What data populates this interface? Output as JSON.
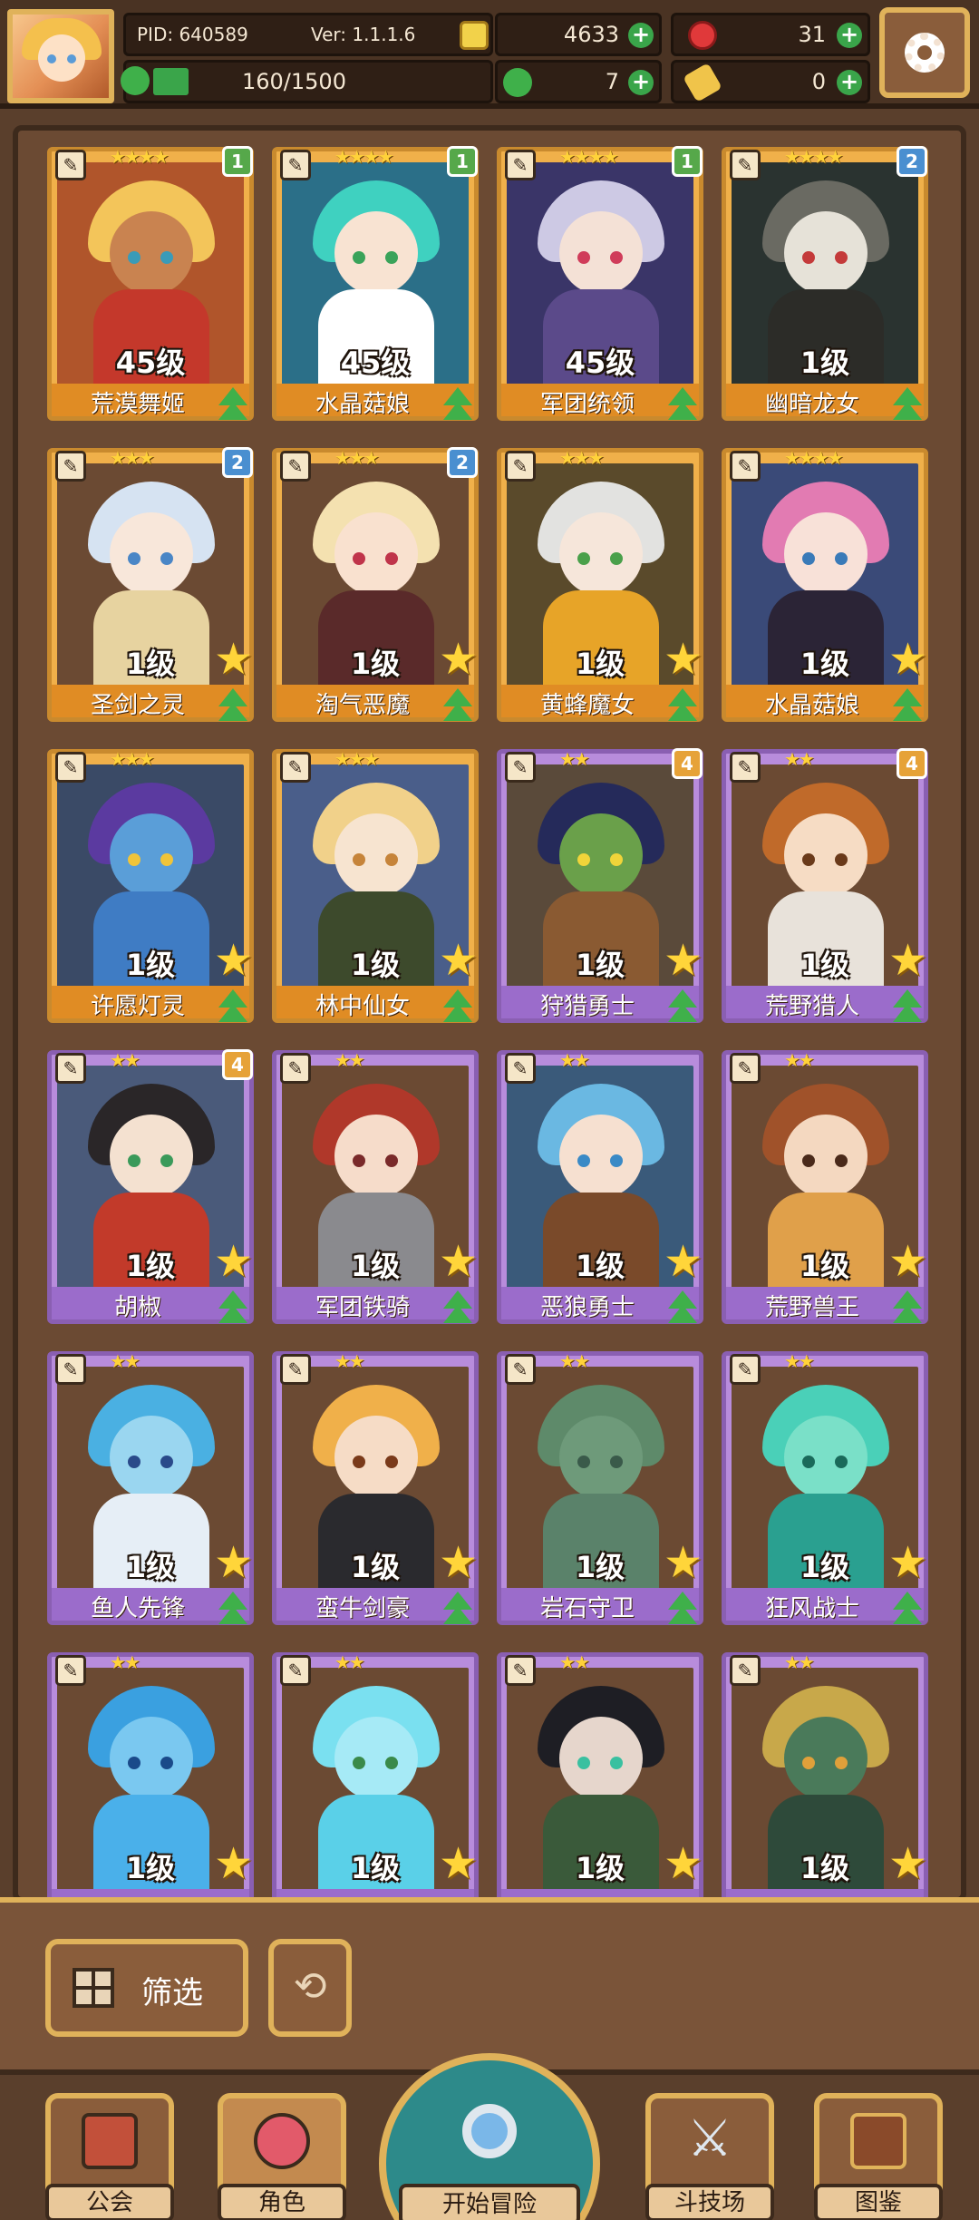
{
  "hud": {
    "pid": "PID: 640589",
    "version": "Ver: 1.1.1.6",
    "gold": "4633",
    "gems": "31",
    "exp": "160/1500",
    "exp_ratio": 0.107,
    "clover": "7",
    "scroll": "0"
  },
  "cards": [
    {
      "name": "荒漠舞姬",
      "level": "45级",
      "stars": "★★★★",
      "rarity": "gold",
      "badge": "1",
      "badge_color": "green",
      "upgrade": true,
      "star_icon": false,
      "palette": {
        "hair": "#f3c55a",
        "skin": "#c98350",
        "body": "#c4382b",
        "bg": "#b0552b",
        "eye": "#3a9bb8"
      }
    },
    {
      "name": "水晶菇娘",
      "level": "45级",
      "stars": "★★★★",
      "rarity": "gold",
      "badge": "1",
      "badge_color": "green",
      "upgrade": true,
      "star_icon": false,
      "palette": {
        "hair": "#3fd1c0",
        "skin": "#f8e3d2",
        "body": "#ffffff",
        "bg": "#2b6f88",
        "eye": "#3aa35a"
      }
    },
    {
      "name": "军团统领",
      "level": "45级",
      "stars": "★★★★",
      "rarity": "gold",
      "badge": "1",
      "badge_color": "green",
      "upgrade": true,
      "star_icon": false,
      "palette": {
        "hair": "#cdc9e4",
        "skin": "#f4e1d6",
        "body": "#5b4a8a",
        "bg": "#3a3568",
        "eye": "#d03c5a"
      }
    },
    {
      "name": "幽暗龙女",
      "level": "1级",
      "stars": "★★★★",
      "rarity": "gold",
      "badge": "2",
      "badge_color": "blue",
      "upgrade": true,
      "star_icon": false,
      "palette": {
        "hair": "#6a6a62",
        "skin": "#e6e2d8",
        "body": "#2c2c28",
        "bg": "#2a3330",
        "eye": "#c43a3a"
      }
    },
    {
      "name": "圣剑之灵",
      "level": "1级",
      "stars": "★★★",
      "rarity": "gold",
      "badge": "2",
      "badge_color": "blue",
      "upgrade": true,
      "star_icon": true,
      "palette": {
        "hair": "#d6e3f2",
        "skin": "#f8e7da",
        "body": "#e7d3a0",
        "bg": "#6b4a33",
        "eye": "#4a86c6"
      }
    },
    {
      "name": "淘气恶魔",
      "level": "1级",
      "stars": "★★★",
      "rarity": "gold",
      "badge": "2",
      "badge_color": "blue",
      "upgrade": true,
      "star_icon": true,
      "palette": {
        "hair": "#f4e1b0",
        "skin": "#f9e1cf",
        "body": "#5a2a2a",
        "bg": "#6b4a33",
        "eye": "#c0344a"
      }
    },
    {
      "name": "黄蜂魔女",
      "level": "1级",
      "stars": "★★★",
      "rarity": "gold",
      "badge": "",
      "badge_color": "",
      "upgrade": true,
      "star_icon": true,
      "palette": {
        "hair": "#e2e2e0",
        "skin": "#f6e6da",
        "body": "#e7a428",
        "bg": "#5a4a2b",
        "eye": "#4aa04a"
      }
    },
    {
      "name": "水晶菇娘",
      "level": "1级",
      "stars": "★★★★",
      "rarity": "gold",
      "badge": "",
      "badge_color": "",
      "upgrade": true,
      "star_icon": true,
      "palette": {
        "hair": "#e27bb2",
        "skin": "#f8e1d8",
        "body": "#2b2436",
        "bg": "#3a4a78",
        "eye": "#3a7ab8"
      }
    },
    {
      "name": "许愿灯灵",
      "level": "1级",
      "stars": "★★★",
      "rarity": "gold",
      "badge": "",
      "badge_color": "",
      "upgrade": true,
      "star_icon": true,
      "palette": {
        "hair": "#5b3aa0",
        "skin": "#5a9ed8",
        "body": "#3f7cc4",
        "bg": "#3a4a66",
        "eye": "#f0c43a"
      }
    },
    {
      "name": "林中仙女",
      "level": "1级",
      "stars": "★★★",
      "rarity": "gold",
      "badge": "",
      "badge_color": "",
      "upgrade": true,
      "star_icon": true,
      "palette": {
        "hair": "#f1d18a",
        "skin": "#f7e4d0",
        "body": "#3d4a2c",
        "bg": "#4a5e8a",
        "eye": "#c6843a"
      }
    },
    {
      "name": "狩猎勇士",
      "level": "1级",
      "stars": "★★",
      "rarity": "purple",
      "badge": "4",
      "badge_color": "orange",
      "upgrade": true,
      "star_icon": true,
      "palette": {
        "hair": "#252a5a",
        "skin": "#6aa04a",
        "body": "#8a5a32",
        "bg": "#5a4a3a",
        "eye": "#f0d43a"
      }
    },
    {
      "name": "荒野猎人",
      "level": "1级",
      "stars": "★★",
      "rarity": "purple",
      "badge": "4",
      "badge_color": "orange",
      "upgrade": true,
      "star_icon": true,
      "palette": {
        "hair": "#c06a2a",
        "skin": "#f6dcc4",
        "body": "#e8e2da",
        "bg": "#6b4a33",
        "eye": "#6a3a1a"
      }
    },
    {
      "name": "胡椒",
      "level": "1级",
      "stars": "★★",
      "rarity": "purple",
      "badge": "4",
      "badge_color": "orange",
      "upgrade": true,
      "star_icon": true,
      "palette": {
        "hair": "#2a2628",
        "skin": "#f4e1d0",
        "body": "#c23a2a",
        "bg": "#4a5a7a",
        "eye": "#3a9a5a"
      }
    },
    {
      "name": "军团铁骑",
      "level": "1级",
      "stars": "★★",
      "rarity": "purple",
      "badge": "",
      "badge_color": "",
      "upgrade": true,
      "star_icon": true,
      "palette": {
        "hair": "#b0382a",
        "skin": "#f6dcca",
        "body": "#8a8a8e",
        "bg": "#6b4a33",
        "eye": "#7a2a2a"
      }
    },
    {
      "name": "恶狼勇士",
      "level": "1级",
      "stars": "★★",
      "rarity": "purple",
      "badge": "",
      "badge_color": "",
      "upgrade": true,
      "star_icon": true,
      "palette": {
        "hair": "#6ab8e2",
        "skin": "#f6e0d0",
        "body": "#7a4a2a",
        "bg": "#3a5a7a",
        "eye": "#3a8ac6"
      }
    },
    {
      "name": "荒野兽王",
      "level": "1级",
      "stars": "★★",
      "rarity": "purple",
      "badge": "",
      "badge_color": "",
      "upgrade": true,
      "star_icon": true,
      "palette": {
        "hair": "#a0522a",
        "skin": "#f4d8c0",
        "body": "#e0a04a",
        "bg": "#6b4a33",
        "eye": "#4a2a1a"
      }
    },
    {
      "name": "鱼人先锋",
      "level": "1级",
      "stars": "★★",
      "rarity": "purple",
      "badge": "",
      "badge_color": "",
      "upgrade": true,
      "star_icon": true,
      "palette": {
        "hair": "#4ab0e2",
        "skin": "#9ad6f0",
        "body": "#e6eef6",
        "bg": "#6b4a33",
        "eye": "#2a4a8a"
      }
    },
    {
      "name": "蛮牛剑豪",
      "level": "1级",
      "stars": "★★",
      "rarity": "purple",
      "badge": "",
      "badge_color": "",
      "upgrade": true,
      "star_icon": true,
      "palette": {
        "hair": "#f0b04a",
        "skin": "#f6dcc6",
        "body": "#2a2a2e",
        "bg": "#6b4a33",
        "eye": "#7a3a1a"
      }
    },
    {
      "name": "岩石守卫",
      "level": "1级",
      "stars": "★★",
      "rarity": "purple",
      "badge": "",
      "badge_color": "",
      "upgrade": true,
      "star_icon": true,
      "palette": {
        "hair": "#5e8a6a",
        "skin": "#6e9a7a",
        "body": "#5a826a",
        "bg": "#6b4a33",
        "eye": "#3a5a4a"
      }
    },
    {
      "name": "狂风战士",
      "level": "1级",
      "stars": "★★",
      "rarity": "purple",
      "badge": "",
      "badge_color": "",
      "upgrade": true,
      "star_icon": true,
      "palette": {
        "hair": "#4ad0b8",
        "skin": "#7ae0c8",
        "body": "#2aa090",
        "bg": "#6b4a33",
        "eye": "#1a6a5a"
      }
    },
    {
      "name": "",
      "level": "1级",
      "stars": "★★",
      "rarity": "purple",
      "badge": "",
      "badge_color": "",
      "upgrade": false,
      "star_icon": true,
      "palette": {
        "hair": "#3aa0e0",
        "skin": "#7ac8f0",
        "body": "#4ab0ea",
        "bg": "#6b4a33",
        "eye": "#1a4a8a"
      }
    },
    {
      "name": "",
      "level": "1级",
      "stars": "★★",
      "rarity": "purple",
      "badge": "",
      "badge_color": "",
      "upgrade": false,
      "star_icon": true,
      "palette": {
        "hair": "#7ae0f0",
        "skin": "#a6eaf6",
        "body": "#5ad0e8",
        "bg": "#6b4a33",
        "eye": "#3a8a4a"
      }
    },
    {
      "name": "",
      "level": "1级",
      "stars": "★★",
      "rarity": "purple",
      "badge": "",
      "badge_color": "",
      "upgrade": false,
      "star_icon": true,
      "palette": {
        "hair": "#1e1e24",
        "skin": "#e6d6cc",
        "body": "#3a5a3a",
        "bg": "#6b4a33",
        "eye": "#3ac0a0"
      }
    },
    {
      "name": "",
      "level": "1级",
      "stars": "★★",
      "rarity": "purple",
      "badge": "",
      "badge_color": "",
      "upgrade": false,
      "star_icon": true,
      "palette": {
        "hair": "#c8a84a",
        "skin": "#4a7a5a",
        "body": "#2e4a3a",
        "bg": "#6b4a33",
        "eye": "#e0a03a"
      }
    }
  ],
  "toolbar": {
    "filter_label": "筛选",
    "reset_icon": "refresh-icon"
  },
  "nav": {
    "guild": "公会",
    "characters": "角色",
    "adventure": "开始冒险",
    "arena": "斗技场",
    "codex": "图鉴"
  },
  "colors": {
    "gold_card": "#f0b04a",
    "purple_card": "#b88cdc",
    "upgrade_green": "#3fb04a",
    "accent_border": "#e0b25a"
  }
}
